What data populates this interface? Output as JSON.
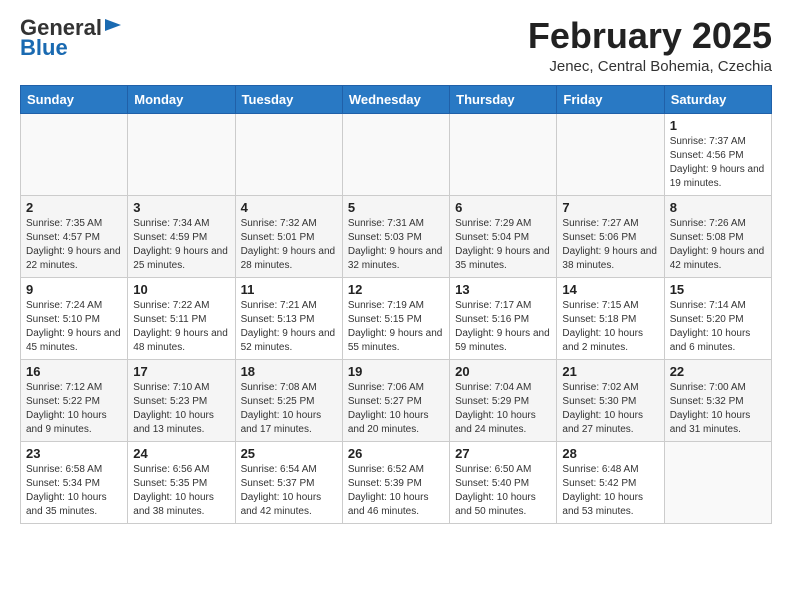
{
  "header": {
    "logo_general": "General",
    "logo_blue": "Blue",
    "title": "February 2025",
    "subtitle": "Jenec, Central Bohemia, Czechia"
  },
  "weekdays": [
    "Sunday",
    "Monday",
    "Tuesday",
    "Wednesday",
    "Thursday",
    "Friday",
    "Saturday"
  ],
  "weeks": [
    [
      {
        "day": "",
        "info": ""
      },
      {
        "day": "",
        "info": ""
      },
      {
        "day": "",
        "info": ""
      },
      {
        "day": "",
        "info": ""
      },
      {
        "day": "",
        "info": ""
      },
      {
        "day": "",
        "info": ""
      },
      {
        "day": "1",
        "info": "Sunrise: 7:37 AM\nSunset: 4:56 PM\nDaylight: 9 hours and 19 minutes."
      }
    ],
    [
      {
        "day": "2",
        "info": "Sunrise: 7:35 AM\nSunset: 4:57 PM\nDaylight: 9 hours and 22 minutes."
      },
      {
        "day": "3",
        "info": "Sunrise: 7:34 AM\nSunset: 4:59 PM\nDaylight: 9 hours and 25 minutes."
      },
      {
        "day": "4",
        "info": "Sunrise: 7:32 AM\nSunset: 5:01 PM\nDaylight: 9 hours and 28 minutes."
      },
      {
        "day": "5",
        "info": "Sunrise: 7:31 AM\nSunset: 5:03 PM\nDaylight: 9 hours and 32 minutes."
      },
      {
        "day": "6",
        "info": "Sunrise: 7:29 AM\nSunset: 5:04 PM\nDaylight: 9 hours and 35 minutes."
      },
      {
        "day": "7",
        "info": "Sunrise: 7:27 AM\nSunset: 5:06 PM\nDaylight: 9 hours and 38 minutes."
      },
      {
        "day": "8",
        "info": "Sunrise: 7:26 AM\nSunset: 5:08 PM\nDaylight: 9 hours and 42 minutes."
      }
    ],
    [
      {
        "day": "9",
        "info": "Sunrise: 7:24 AM\nSunset: 5:10 PM\nDaylight: 9 hours and 45 minutes."
      },
      {
        "day": "10",
        "info": "Sunrise: 7:22 AM\nSunset: 5:11 PM\nDaylight: 9 hours and 48 minutes."
      },
      {
        "day": "11",
        "info": "Sunrise: 7:21 AM\nSunset: 5:13 PM\nDaylight: 9 hours and 52 minutes."
      },
      {
        "day": "12",
        "info": "Sunrise: 7:19 AM\nSunset: 5:15 PM\nDaylight: 9 hours and 55 minutes."
      },
      {
        "day": "13",
        "info": "Sunrise: 7:17 AM\nSunset: 5:16 PM\nDaylight: 9 hours and 59 minutes."
      },
      {
        "day": "14",
        "info": "Sunrise: 7:15 AM\nSunset: 5:18 PM\nDaylight: 10 hours and 2 minutes."
      },
      {
        "day": "15",
        "info": "Sunrise: 7:14 AM\nSunset: 5:20 PM\nDaylight: 10 hours and 6 minutes."
      }
    ],
    [
      {
        "day": "16",
        "info": "Sunrise: 7:12 AM\nSunset: 5:22 PM\nDaylight: 10 hours and 9 minutes."
      },
      {
        "day": "17",
        "info": "Sunrise: 7:10 AM\nSunset: 5:23 PM\nDaylight: 10 hours and 13 minutes."
      },
      {
        "day": "18",
        "info": "Sunrise: 7:08 AM\nSunset: 5:25 PM\nDaylight: 10 hours and 17 minutes."
      },
      {
        "day": "19",
        "info": "Sunrise: 7:06 AM\nSunset: 5:27 PM\nDaylight: 10 hours and 20 minutes."
      },
      {
        "day": "20",
        "info": "Sunrise: 7:04 AM\nSunset: 5:29 PM\nDaylight: 10 hours and 24 minutes."
      },
      {
        "day": "21",
        "info": "Sunrise: 7:02 AM\nSunset: 5:30 PM\nDaylight: 10 hours and 27 minutes."
      },
      {
        "day": "22",
        "info": "Sunrise: 7:00 AM\nSunset: 5:32 PM\nDaylight: 10 hours and 31 minutes."
      }
    ],
    [
      {
        "day": "23",
        "info": "Sunrise: 6:58 AM\nSunset: 5:34 PM\nDaylight: 10 hours and 35 minutes."
      },
      {
        "day": "24",
        "info": "Sunrise: 6:56 AM\nSunset: 5:35 PM\nDaylight: 10 hours and 38 minutes."
      },
      {
        "day": "25",
        "info": "Sunrise: 6:54 AM\nSunset: 5:37 PM\nDaylight: 10 hours and 42 minutes."
      },
      {
        "day": "26",
        "info": "Sunrise: 6:52 AM\nSunset: 5:39 PM\nDaylight: 10 hours and 46 minutes."
      },
      {
        "day": "27",
        "info": "Sunrise: 6:50 AM\nSunset: 5:40 PM\nDaylight: 10 hours and 50 minutes."
      },
      {
        "day": "28",
        "info": "Sunrise: 6:48 AM\nSunset: 5:42 PM\nDaylight: 10 hours and 53 minutes."
      },
      {
        "day": "",
        "info": ""
      }
    ]
  ]
}
